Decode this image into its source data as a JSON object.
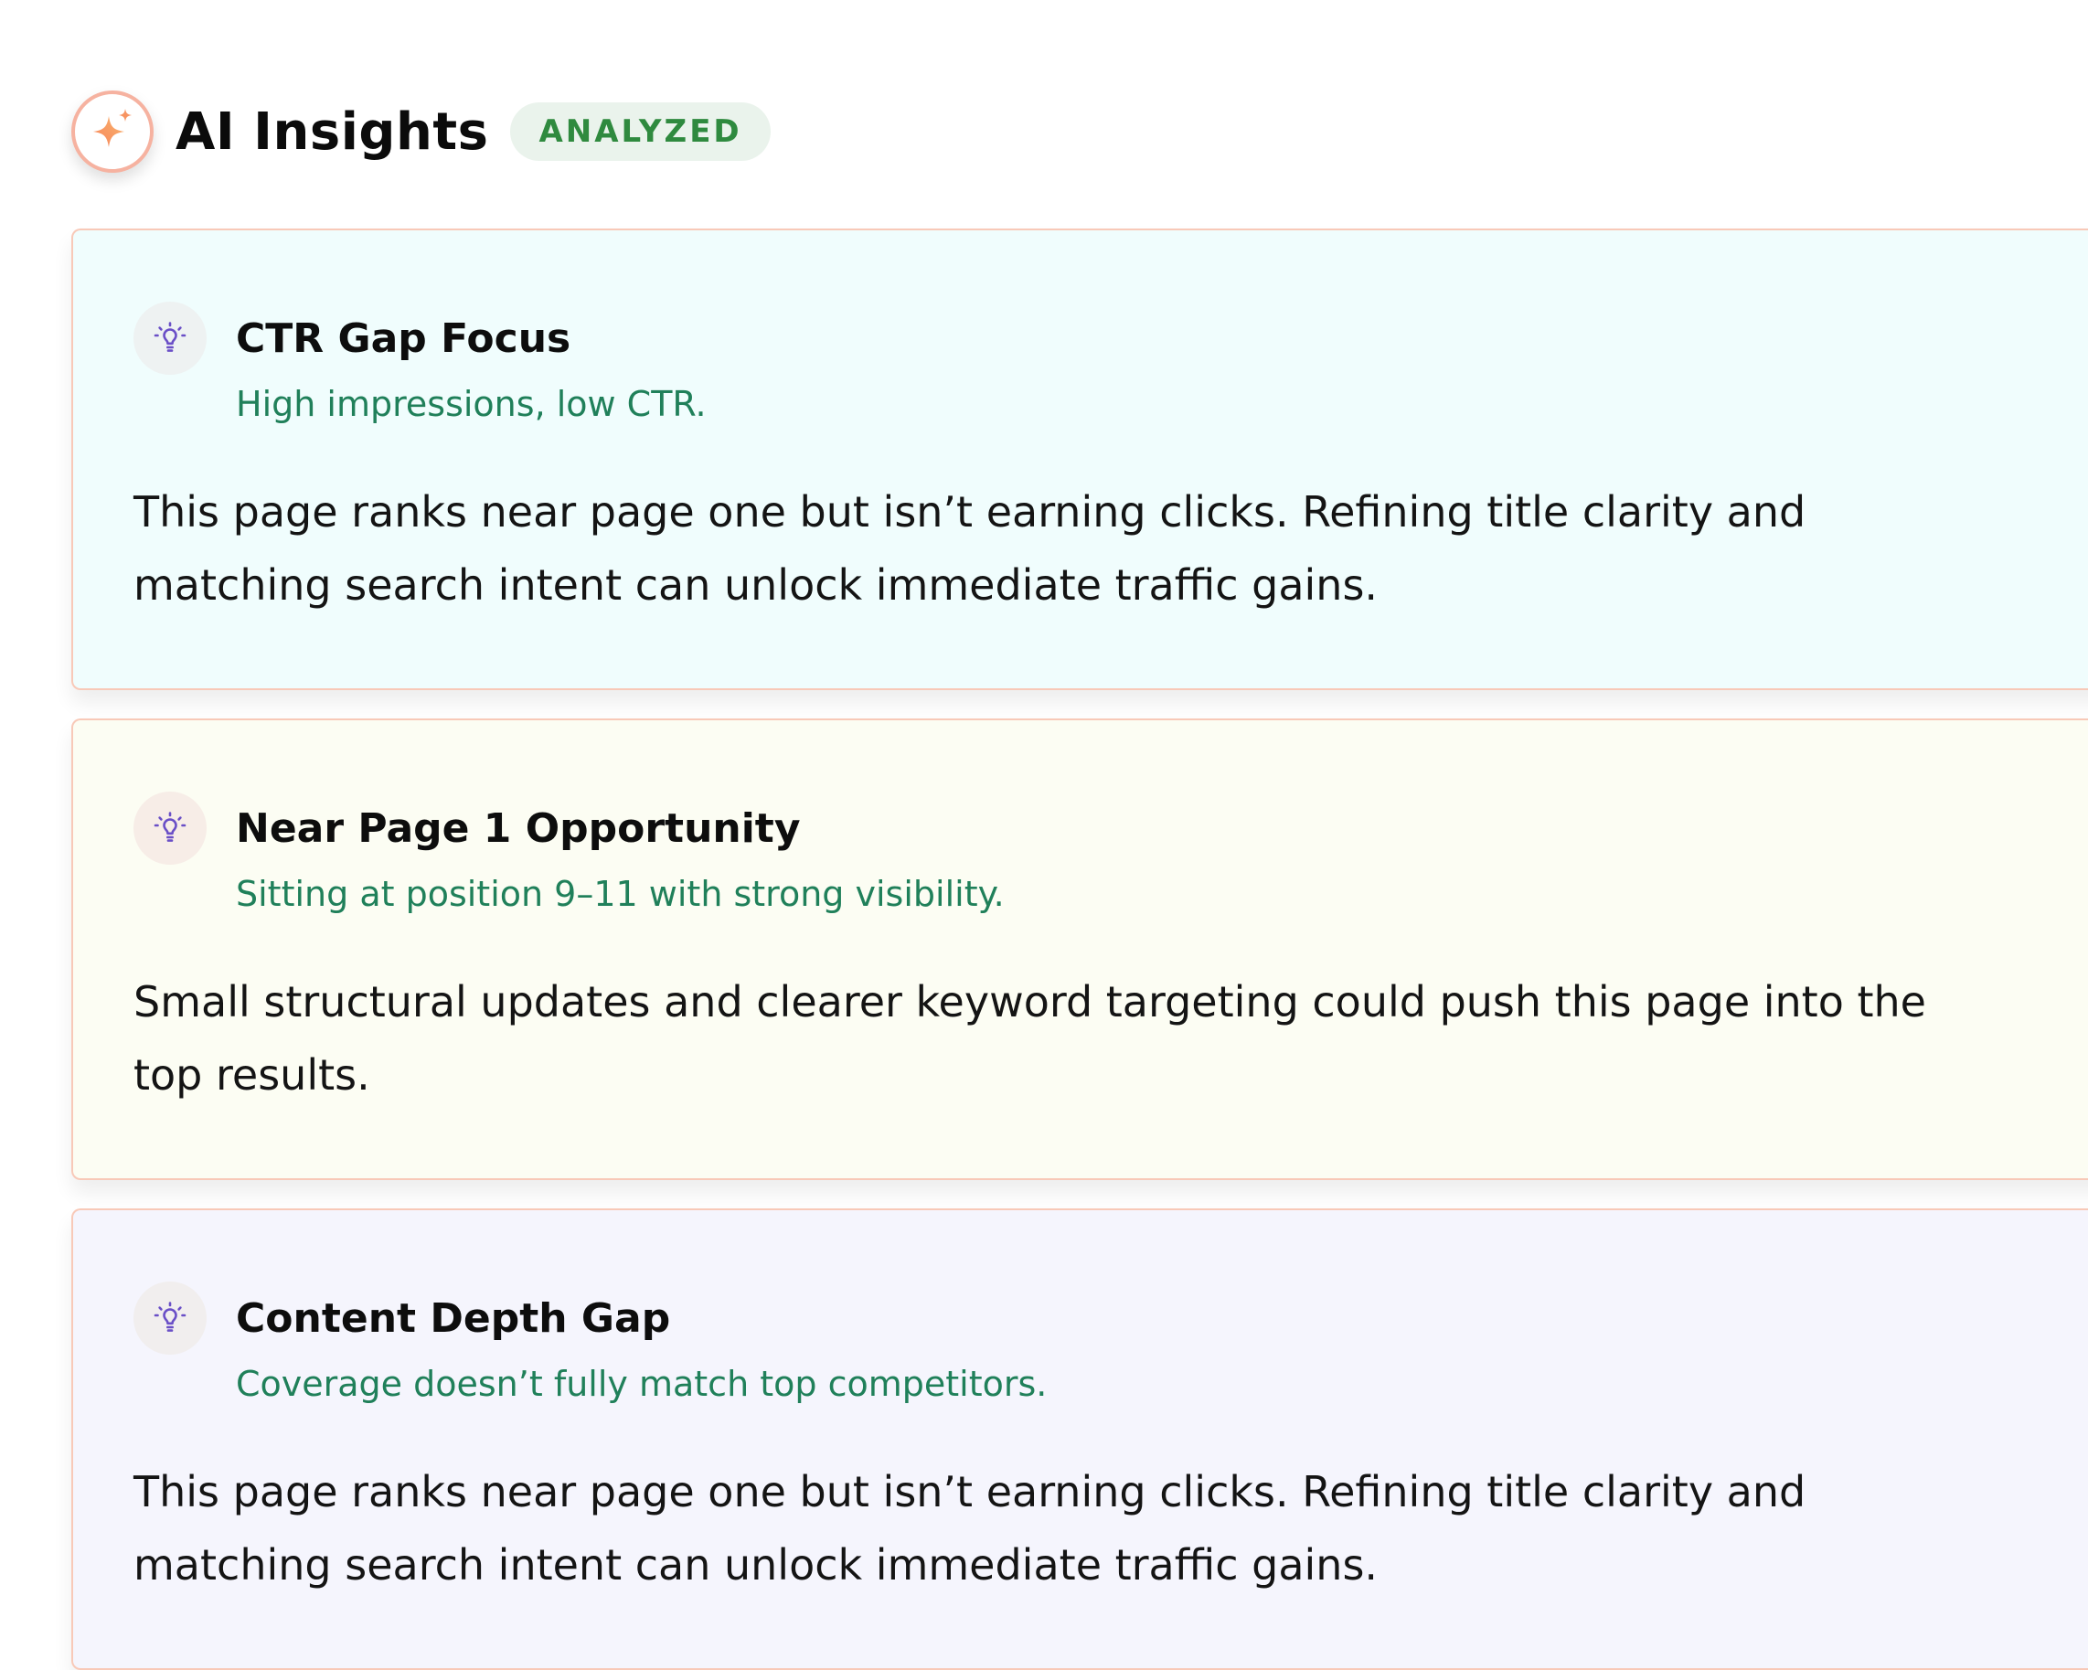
{
  "header": {
    "icon": "sparkle-icon",
    "title": "AI Insights",
    "badge": "ANALYZED"
  },
  "colors": {
    "badge_bg": "#eaf3ec",
    "badge_text": "#2f8a3f",
    "subtitle": "#20805a",
    "card_border": "#f8c9b8",
    "bulb_icon": "#6a4fc7"
  },
  "insights": [
    {
      "icon": "lightbulb-icon",
      "title": "CTR Gap Focus",
      "subtitle": "High impressions, low CTR.",
      "body": "This page ranks near page one but isn’t earning clicks. Refining title clarity and matching search intent can unlock immediate traffic gains.",
      "background": "#f0fdfd",
      "icon_bg": "#eef2f2"
    },
    {
      "icon": "lightbulb-icon",
      "title": "Near Page 1 Opportunity",
      "subtitle": "Sitting at position 9–11 with strong visibility.",
      "body": "Small structural updates and clearer keyword targeting could push this page into the top results.",
      "background": "#fcfdf3",
      "icon_bg": "#f7ede7"
    },
    {
      "icon": "lightbulb-icon",
      "title": "Content Depth Gap",
      "subtitle": "Coverage doesn’t fully match top competitors.",
      "body": "This page ranks near page one but isn’t earning clicks. Refining title clarity and matching search intent can unlock immediate traffic gains.",
      "background": "#f5f5fd",
      "icon_bg": "#f1eeee"
    }
  ]
}
